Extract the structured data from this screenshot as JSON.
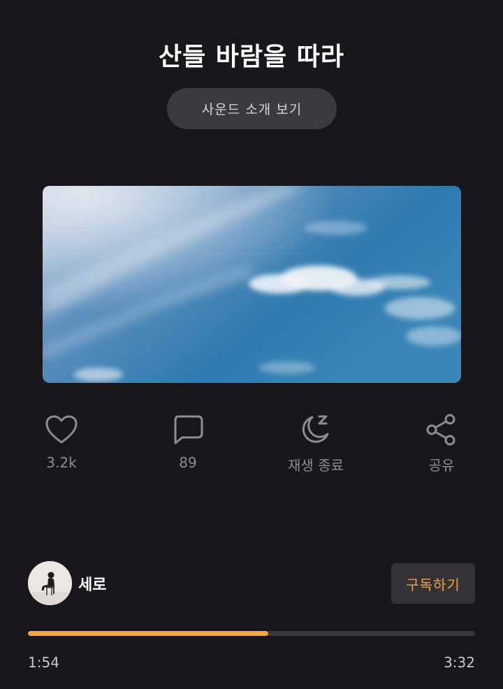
{
  "header": {
    "title": "산들 바람을 따라",
    "intro_button_label": "사운드 소개 보기"
  },
  "actions": [
    {
      "icon": "heart-icon",
      "label": "3.2k"
    },
    {
      "icon": "comment-icon",
      "label": "89"
    },
    {
      "icon": "sleep-timer-icon",
      "label": "재생 종료"
    },
    {
      "icon": "share-icon",
      "label": "공유"
    }
  ],
  "channel": {
    "name": "세로",
    "subscribe_label": "구독하기"
  },
  "player": {
    "current_time": "1:54",
    "total_time": "3:32",
    "progress": 0.538
  },
  "colors": {
    "background": "#19171b",
    "accent": "#f5a53c",
    "icon_gray": "#8e8c91"
  }
}
